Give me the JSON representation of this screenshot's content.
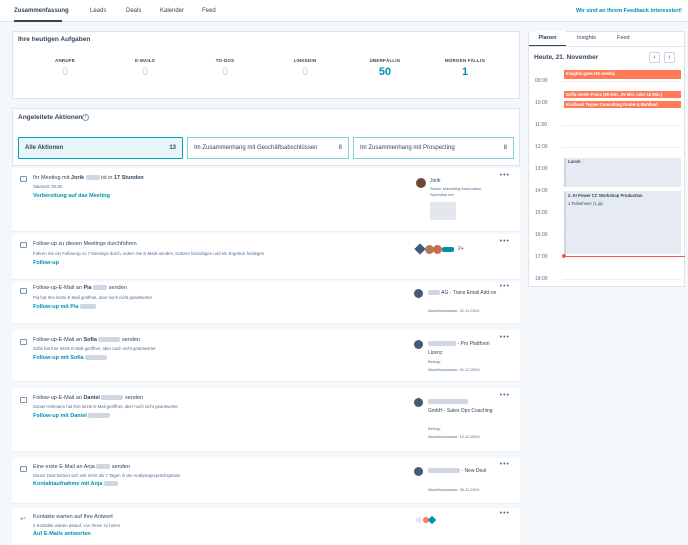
{
  "tabs": [
    "Zusammenfassung",
    "Leads",
    "Deals",
    "Kalender",
    "Feed"
  ],
  "feedback": "Wir sind an Ihrem Feedback interessiert!",
  "tasks": {
    "title": "Ihre heutigen Aufgaben",
    "stats": [
      {
        "label": "ANRUFE",
        "value": "0"
      },
      {
        "label": "E-MAILS",
        "value": "0"
      },
      {
        "label": "TO-DOS",
        "value": "0"
      },
      {
        "label": "LINKEDIN",
        "value": "0"
      },
      {
        "label": "ÜBERFÄLLIG",
        "value": "50"
      },
      {
        "label": "MORGEN FÄLLIG",
        "value": "1"
      }
    ]
  },
  "actions": {
    "title": "Angeleitete Aktionen",
    "info_icon": "info-icon",
    "filters": [
      {
        "label": "Alle Aktionen",
        "count": "13"
      },
      {
        "label": "Im Zusammenhang mit Geschäftsabschlüssen",
        "count": "8"
      },
      {
        "label": "Im Zusammenhang mit Prospecting",
        "count": "8"
      }
    ],
    "rows": [
      {
        "t1": "Ihr Meeting mit ",
        "t2": "Jorik",
        "t3": " ist in ",
        "t4": "17 Stunden",
        "sub": "Startzeit: 09:30",
        "link": "Vorbereitung auf das Meeting",
        "icon": "calendar-icon",
        "contact": {
          "name": "Jorik",
          "role": "Senior Marketing Automation Specialist bei"
        }
      },
      {
        "t1": "Follow-up zu diesen Meetings durchführen",
        "sub": "Führen Sie ein Follow-up zu 7 Meetings durch, indem Sie E-Mails senden, Notizen hinzufügen und ein Ergebnis festlegen",
        "link": "Follow-up",
        "icon": "calendar-icon",
        "avatars_more": "2+"
      },
      {
        "t1": "Follow-up-E-Mail an ",
        "t2": "Pia",
        "t3": " senden",
        "sub": "Pia  hat Ihre letzte E-Mail geöffnet, aber noch nicht geantwortet",
        "link": "Follow-up mit Pia",
        "icon": "email-icon",
        "deal": {
          "name": "AG - Trans Email Add-on",
          "close": "Abschlussdatum: 21.11.2024"
        }
      },
      {
        "t1": "Follow-up-E-Mail an ",
        "t2": "Sofia",
        "t3": " senden",
        "sub": "Sofia  hat Ihre letzte E-Mail geöffnet, aber noch nicht geantwortet",
        "link": "Follow-up mit Sofia",
        "icon": "email-icon",
        "deal": {
          "name": "- Pro Plattform Lizenz",
          "amount": "Betrag:",
          "close": "Abschlussdatum: 31.12.2024"
        }
      },
      {
        "t1": "Follow-up-E-Mail an ",
        "t2": "Daniel",
        "t3": " senden",
        "sub": "Daniel Hohmann hat Ihre letzte E-Mail geöffnet, aber noch nicht geantwortet",
        "link": "Follow-up mit Daniel",
        "icon": "email-icon",
        "deal": {
          "name": "GmbH - Sales Ops Coaching",
          "amount": "Betrag:",
          "close": "Abschlussdatum: 12.10.2024"
        }
      },
      {
        "t1": "Eine erste E-Mail an Anja ",
        "t3": " senden",
        "sub": "Dieser Deal befand sich seit mehr als 7 Tagen in der Analysegesprächsphase",
        "link": "Kontaktaufnahme mit Anja",
        "icon": "email-icon",
        "deal": {
          "name": "- New Deal",
          "close": "Abschlussdatum: 30.11.2024"
        }
      },
      {
        "t1": "Kontakte warten auf Ihre Antwort",
        "sub": "2 Kontakte warten darauf, von Ihnen zu hören",
        "link": "Auf E-Mails antworten",
        "icon": "reply-icon"
      }
    ]
  },
  "cal": {
    "tabs": [
      "Planen",
      "Insights",
      "Feed"
    ],
    "date": "Heute, 21. November",
    "hours": [
      "09:00",
      "10:00",
      "11:00",
      "12:00",
      "13:00",
      "14:00",
      "15:00",
      "16:00",
      "17:00",
      "18:00"
    ],
    "events": [
      "Insights goes HS weekly",
      "Sofia meets Franz (45 Min., 25 Min. oder 15 Min.)",
      "Kickback Teipen Consulting GmbH & Buhlbod",
      "Lunch",
      "2. KI Power CC Workshop Production",
      "1 Teilnehmer (1 ja)"
    ]
  }
}
